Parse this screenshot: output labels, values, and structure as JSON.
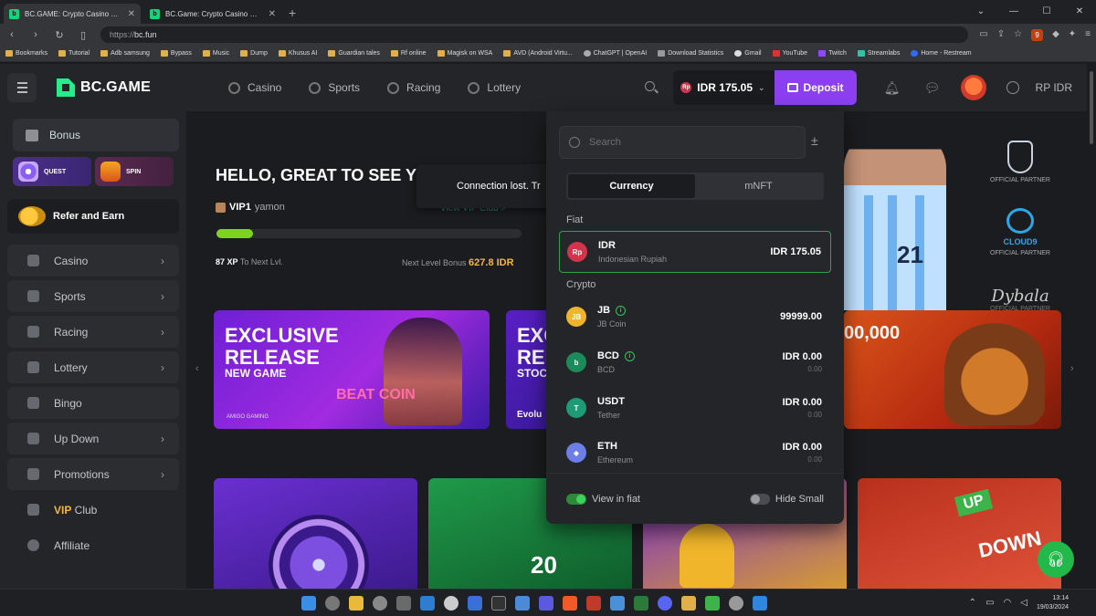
{
  "browser": {
    "tabs": [
      {
        "title": "BC.GAME: Crypto Casino Games &",
        "active": true
      },
      {
        "title": "BC.Game: Crypto Casino Games & C",
        "active": false
      }
    ],
    "url_scheme": "https://",
    "url_host": "bc.fun",
    "bookmarks": [
      "Bookmarks",
      "Tutorial",
      "Adb samsung",
      "Bypass",
      "Music",
      "Dump",
      "Khusus AI",
      "Guardian tales",
      "Rf online",
      "Magisk on WSA",
      "AVD (Android Virtu...",
      "ChatGPT | OpenAI",
      "Download Statistics",
      "Gmail",
      "YouTube",
      "Twitch",
      "Streamlabs",
      "Home - Restream"
    ],
    "extension_badge": "9"
  },
  "header": {
    "logo": "BC.GAME",
    "nav": [
      "Casino",
      "Sports",
      "Racing",
      "Lottery"
    ],
    "balance": "IDR 175.05",
    "deposit": "Deposit",
    "currency_label": "RP IDR"
  },
  "sidebar": {
    "bonus": "Bonus",
    "quest": "QUEST",
    "spin": "SPIN",
    "refer": "Refer and Earn",
    "items": [
      {
        "label": "Casino",
        "chevron": true
      },
      {
        "label": "Sports",
        "chevron": true
      },
      {
        "label": "Racing",
        "chevron": true
      },
      {
        "label": "Lottery",
        "chevron": true
      },
      {
        "label": "Bingo",
        "chevron": false
      },
      {
        "label": "Up Down",
        "chevron": true
      },
      {
        "label": "Promotions",
        "chevron": true
      }
    ],
    "vip_prefix": "VIP",
    "vip_suffix": " Club",
    "affiliate": "Affiliate"
  },
  "main": {
    "greeting": "HELLO, GREAT TO SEE Y",
    "vip_level": "VIP1",
    "username": "yamon",
    "progress": 0.12,
    "xp": "87 XP",
    "xp_suffix": " To Next Lvl.",
    "next_bonus_label": "Next Level Bonus ",
    "next_bonus_value": "627.8 IDR",
    "toast": "Connection lost. Tr",
    "vip_link": "View VIP Club  >",
    "banner1": {
      "line1": "EXCLUSIVE",
      "line2": "RELEASE",
      "line3": "NEW GAME",
      "game": "BEAT COIN",
      "studio": "AMIGO GAMING"
    },
    "banner2": {
      "line1": "EXC",
      "line2": "REL",
      "line3": "STOC",
      "studio": "Evolu"
    },
    "banner3": {
      "amount": "00,000"
    },
    "jersey_number": "21",
    "partners": {
      "afa_label": "OFFICIAL PARTNER",
      "cloud9_name": "CLOUD9",
      "cloud9_label": "OFFICIAL PARTNER",
      "signature": "Dybala",
      "sig_label": "OFFICIAL PARTNER"
    },
    "tiles": {
      "t2_number": "20",
      "t4_up": "UP",
      "t4_down": "DOWN"
    }
  },
  "currency_dropdown": {
    "search_placeholder": "Search",
    "tabs": [
      "Currency",
      "mNFT"
    ],
    "fiat_heading": "Fiat",
    "crypto_heading": "Crypto",
    "fiat": [
      {
        "symbol": "IDR",
        "name": "Indonesian Rupiah",
        "amount": "IDR 175.05",
        "sub": "",
        "color": "#d3344b",
        "glyph": "Rp"
      }
    ],
    "crypto": [
      {
        "symbol": "JB",
        "name": "JB Coin",
        "amount": "99999.00",
        "sub": "",
        "color": "#f0b52a",
        "glyph": "JB",
        "info": true
      },
      {
        "symbol": "BCD",
        "name": "BCD",
        "amount": "IDR 0.00",
        "sub": "0.00",
        "color": "#1c8b5a",
        "glyph": "b",
        "info": true
      },
      {
        "symbol": "USDT",
        "name": "Tether",
        "amount": "IDR 0.00",
        "sub": "0.00",
        "color": "#1d9a76",
        "glyph": "T",
        "info": false
      },
      {
        "symbol": "ETH",
        "name": "Ethereum",
        "amount": "IDR 0.00",
        "sub": "0.00",
        "color": "#6b7fe6",
        "glyph": "◆",
        "info": false
      }
    ],
    "view_in_fiat": "View in fiat",
    "view_in_fiat_on": true,
    "hide_small": "Hide Small",
    "hide_small_on": false
  },
  "taskbar": {
    "time": "13:14",
    "date": "19/03/2024"
  },
  "colors": {
    "accent_green": "#24ee89",
    "deposit_purple": "#8b3ff0",
    "vip_gold": "#f5b73c",
    "selected_border": "#2da34f"
  }
}
